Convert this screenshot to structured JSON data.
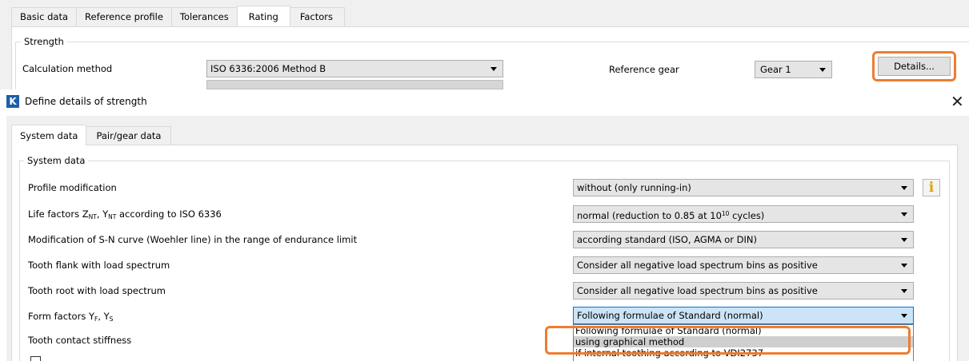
{
  "top_window": {
    "tabs": [
      "Basic data",
      "Reference profile",
      "Tolerances",
      "Rating",
      "Factors"
    ],
    "active_tab_index": 3,
    "group_title": "Strength",
    "calc_method_label": "Calculation method",
    "calc_method_value": "ISO 6336:2006 Method B",
    "ref_gear_label": "Reference gear",
    "ref_gear_value": "Gear 1",
    "details_button": "Details..."
  },
  "dialog": {
    "title": "Define details of strength",
    "tabs": [
      "System data",
      "Pair/gear data"
    ],
    "active_tab_index": 0,
    "group_title": "System data",
    "rows": [
      {
        "label": "Profile modification",
        "value": "without (only running-in)"
      },
      {
        "label_main": "Life factors Z",
        "label_sub1": "NT",
        "label_mid": ", Y",
        "label_sub2": "NT",
        "label_tail": " according to ISO 6336",
        "value_main": "normal (reduction to 0.85 at 10",
        "value_sup": "10",
        "value_tail": " cycles)"
      },
      {
        "label": "Modification of S-N curve (Woehler line) in the range of endurance limit",
        "value": "according standard (ISO, AGMA or DIN)"
      },
      {
        "label": "Tooth flank with load spectrum",
        "value": "Consider all negative load spectrum bins as positive"
      },
      {
        "label": "Tooth root with load spectrum",
        "value": "Consider all negative load spectrum bins as positive"
      },
      {
        "label_main": "Form factors Y",
        "label_sub1": "F",
        "label_mid": ", Y",
        "label_sub2": "S",
        "value": "Following formulae of Standard (normal)"
      },
      {
        "label": "Tooth contact stiffness"
      }
    ],
    "dropdown_options": [
      "Following formulae of Standard (normal)",
      "using graphical method",
      "if internal toothing according to VDI2737"
    ],
    "dropdown_selected_index": 1,
    "highlight_color": "#ed7d31",
    "info_icon": "info-icon",
    "close_icon": "close-icon"
  }
}
